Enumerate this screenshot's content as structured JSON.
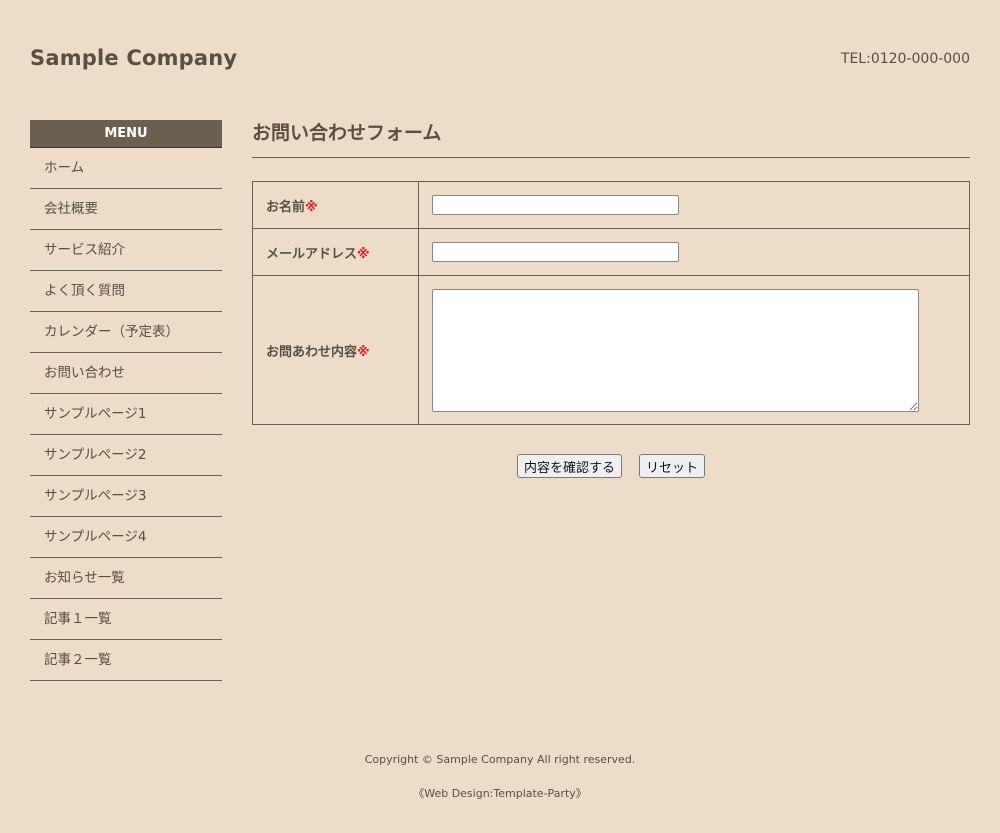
{
  "header": {
    "logo": "Sample Company",
    "tel": "TEL:0120-000-000"
  },
  "sidebar": {
    "heading": "MENU",
    "items": [
      {
        "label": "ホーム"
      },
      {
        "label": "会社概要"
      },
      {
        "label": "サービス紹介"
      },
      {
        "label": "よく頂く質問"
      },
      {
        "label": "カレンダー（予定表）"
      },
      {
        "label": "お問い合わせ"
      },
      {
        "label": "サンプルページ1"
      },
      {
        "label": "サンプルページ2"
      },
      {
        "label": "サンプルページ3"
      },
      {
        "label": "サンプルページ4"
      },
      {
        "label": "お知らせ一覧"
      },
      {
        "label": "記事１一覧"
      },
      {
        "label": "記事２一覧"
      }
    ]
  },
  "main": {
    "title": "お問い合わせフォーム",
    "form": {
      "required_mark": "※",
      "fields": [
        {
          "label": "お名前",
          "value": "",
          "placeholder": ""
        },
        {
          "label": "メールアドレス",
          "value": "",
          "placeholder": ""
        },
        {
          "label": "お問あわせ内容",
          "value": "",
          "placeholder": ""
        }
      ],
      "submit_label": "内容を確認する",
      "reset_label": "リセット"
    }
  },
  "footer": {
    "copyright": "Copyright © Sample Company All right reserved.",
    "credit": "《Web Design:Template-Party》"
  },
  "colors": {
    "background": "#ecdcc8",
    "text": "#5a5040",
    "menu_header": "#6b6050",
    "required": "#d8262d"
  }
}
